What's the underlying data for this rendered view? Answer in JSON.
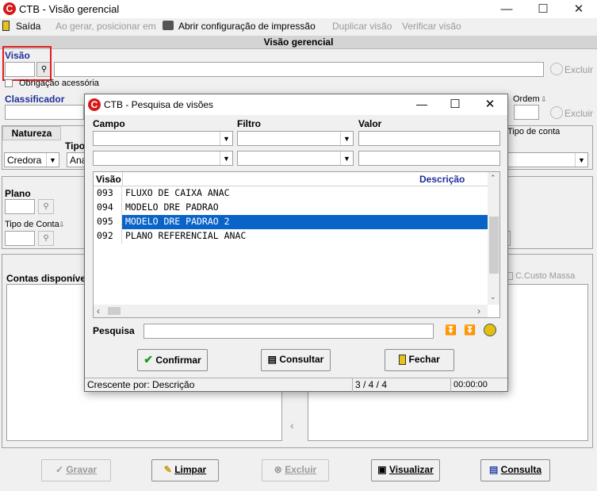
{
  "window": {
    "title": "CTB - Visão gerencial",
    "logo": "C"
  },
  "menu": {
    "exit": "Saída",
    "position_on_generate": "Ao gerar, posicionar em",
    "print_config": "Abrir configuração de impressão",
    "duplicate_view": "Duplicar visão",
    "verify_view": "Verificar visão"
  },
  "banner": "Visão gerencial",
  "form": {
    "visao_label": "Visão",
    "obrigacao_label": "Obrigação acessória",
    "excluir_label": "Excluir",
    "classificador_label": "Classificador",
    "ordem_label": "Ordem",
    "natureza_header": "Natureza",
    "natureza_value": "Credora",
    "tipo_header": "Tipo",
    "tipo_value": "Ana",
    "tipo_conta_header": "Tipo de conta",
    "plano_label": "Plano",
    "tipo_conta_label": "Tipo de Conta",
    "contas_disponiveis": "Contas disponíve",
    "ccusto_massa": "C.Custo Massa"
  },
  "footer": {
    "gravar": "Gravar",
    "limpar": "Limpar",
    "excluir": "Excluir",
    "visualizar": "Visualizar",
    "consulta": "Consulta"
  },
  "dialog": {
    "title": "CTB - Pesquisa de visões",
    "campo_label": "Campo",
    "filtro_label": "Filtro",
    "valor_label": "Valor",
    "grid": {
      "col_visao": "Visão",
      "col_descricao": "Descrição",
      "rows": [
        {
          "code": "093",
          "desc": "FLUXO DE CAIXA ANAC"
        },
        {
          "code": "094",
          "desc": "MODELO DRE PADRAO"
        },
        {
          "code": "095",
          "desc": "MODELO DRE PADRAO 2"
        },
        {
          "code": "092",
          "desc": "PLANO REFERENCIAL ANAC"
        }
      ],
      "selected_row": 2
    },
    "pesquisa_label": "Pesquisa",
    "confirmar": "Confirmar",
    "consultar": "Consultar",
    "fechar": "Fechar",
    "status": {
      "order": "Crescente por: Descrição",
      "count": "3 / 4 / 4",
      "time": "00:00:00"
    }
  },
  "colors": {
    "accent_blue": "#1f2f9a",
    "selection": "#0a64c8",
    "highlight_box": "#e02020",
    "logo_red": "#d51a1a"
  }
}
